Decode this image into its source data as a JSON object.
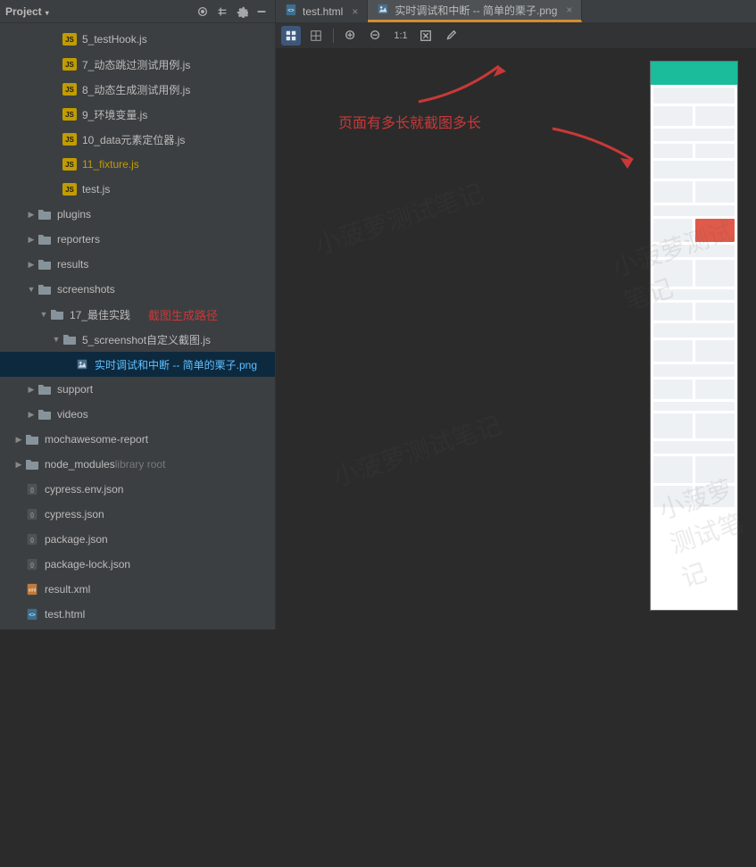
{
  "project_header": {
    "title": "Project"
  },
  "toolbar_icons": [
    "target-icon",
    "collapse-icon",
    "gear-icon",
    "minimize-icon"
  ],
  "tree": [
    {
      "indent": 3,
      "arrow": "none",
      "icon": "js",
      "label": "5_testHook.js"
    },
    {
      "indent": 3,
      "arrow": "none",
      "icon": "js",
      "label": "7_动态跳过测试用例.js"
    },
    {
      "indent": 3,
      "arrow": "none",
      "icon": "js",
      "label": "8_动态生成测试用例.js"
    },
    {
      "indent": 3,
      "arrow": "none",
      "icon": "js",
      "label": "9_环境变量.js"
    },
    {
      "indent": 3,
      "arrow": "none",
      "icon": "js",
      "label": "10_data元素定位器.js"
    },
    {
      "indent": 3,
      "arrow": "none",
      "icon": "js",
      "label": "11_fixture.js",
      "hl": true
    },
    {
      "indent": 3,
      "arrow": "none",
      "icon": "js",
      "label": "test.js"
    },
    {
      "indent": 1,
      "arrow": "collapse",
      "icon": "folder",
      "label": "plugins"
    },
    {
      "indent": 1,
      "arrow": "collapse",
      "icon": "folder",
      "label": "reporters"
    },
    {
      "indent": 1,
      "arrow": "collapse",
      "icon": "folder",
      "label": "results"
    },
    {
      "indent": 1,
      "arrow": "expand",
      "icon": "folder",
      "label": "screenshots"
    },
    {
      "indent": 2,
      "arrow": "expand",
      "icon": "folder",
      "label": "17_最佳实践",
      "annot": "截图生成路径"
    },
    {
      "indent": 3,
      "arrow": "expand",
      "icon": "folder",
      "label": "5_screenshot自定义截图.js"
    },
    {
      "indent": 4,
      "arrow": "none",
      "icon": "png",
      "label": "实时调试和中断 -- 简单的栗子.png",
      "selected": true
    },
    {
      "indent": 1,
      "arrow": "collapse",
      "icon": "folder",
      "label": "support"
    },
    {
      "indent": 1,
      "arrow": "collapse",
      "icon": "folder",
      "label": "videos"
    },
    {
      "indent": 0,
      "arrow": "collapse",
      "icon": "folder",
      "label": "mochawesome-report"
    },
    {
      "indent": 0,
      "arrow": "collapse",
      "icon": "folder",
      "label": "node_modules",
      "suffix": "library root",
      "muted": true
    },
    {
      "indent": 0,
      "arrow": "none",
      "icon": "json",
      "label": "cypress.env.json"
    },
    {
      "indent": 0,
      "arrow": "none",
      "icon": "json",
      "label": "cypress.json"
    },
    {
      "indent": 0,
      "arrow": "none",
      "icon": "json",
      "label": "package.json"
    },
    {
      "indent": 0,
      "arrow": "none",
      "icon": "json",
      "label": "package-lock.json"
    },
    {
      "indent": 0,
      "arrow": "none",
      "icon": "xml",
      "label": "result.xml"
    },
    {
      "indent": 0,
      "arrow": "none",
      "icon": "html",
      "label": "test.html"
    }
  ],
  "tabs": [
    {
      "icon": "html",
      "label": "test.html",
      "active": false
    },
    {
      "icon": "png",
      "label": "实时调试和中断 -- 简单的栗子.png",
      "active": true
    }
  ],
  "img_toolbar": {
    "btn_grid_blue": "grid-blue-icon",
    "btn_grid": "grid-icon",
    "btn_zoom_in": "zoom-in-icon",
    "btn_zoom_out": "zoom-out-icon",
    "btn_one_one": "1:1",
    "btn_fit": "fit-icon",
    "btn_eyedropper": "eyedropper-icon"
  },
  "canvas_annotation": "页面有多长就截图多长",
  "watermark": "小菠萝测试笔记"
}
